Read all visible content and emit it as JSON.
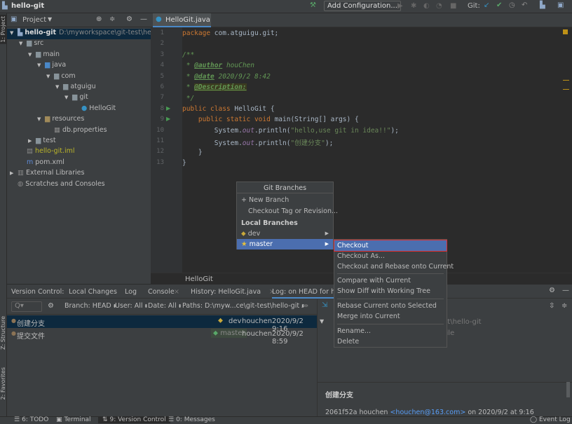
{
  "title": "hello-git",
  "toolbar": {
    "add_config": "Add Configuration...",
    "git_label": "Git:"
  },
  "left_strip": {
    "project": "1: Project",
    "structure": "Z: Structure",
    "favorites": "2: Favorites"
  },
  "project": {
    "header": "Project",
    "tree": [
      {
        "label": "hello-git",
        "path": "D:\\myworkspace\\git-test\\hello-git",
        "indent": 0,
        "icon": "module-folder"
      },
      {
        "label": "src",
        "indent": 1,
        "icon": "folder"
      },
      {
        "label": "main",
        "indent": 2,
        "icon": "folder"
      },
      {
        "label": "java",
        "indent": 3,
        "icon": "source-folder"
      },
      {
        "label": "com",
        "indent": 4,
        "icon": "package"
      },
      {
        "label": "atguigu",
        "indent": 5,
        "icon": "package"
      },
      {
        "label": "git",
        "indent": 6,
        "icon": "package"
      },
      {
        "label": "HelloGit",
        "indent": 7,
        "icon": "class"
      },
      {
        "label": "resources",
        "indent": 3,
        "icon": "resources-folder"
      },
      {
        "label": "db.properties",
        "indent": 4,
        "icon": "properties-file"
      },
      {
        "label": "test",
        "indent": 2,
        "icon": "folder"
      },
      {
        "label": "hello-git.iml",
        "indent": 1,
        "icon": "iml-file"
      },
      {
        "label": "pom.xml",
        "indent": 1,
        "icon": "maven-file"
      },
      {
        "label": "External Libraries",
        "indent": 0,
        "icon": "libraries"
      },
      {
        "label": "Scratches and Consoles",
        "indent": 0,
        "icon": "scratches"
      }
    ]
  },
  "editor": {
    "tab": "HelloGit.java",
    "breadcrumb": "HelloGit",
    "lines": [
      "1",
      "2",
      "3",
      "4",
      "5",
      "6",
      "7",
      "8",
      "9",
      "10",
      "11",
      "12",
      "13"
    ],
    "code": {
      "l1a": "package",
      "l1b": " com.atguigu.git;",
      "l3": "/**",
      "l4a": " * ",
      "l4b": "@author",
      "l4c": " houChen",
      "l5a": " * ",
      "l5b": "@date",
      "l5c": " 2020/9/2 8:42",
      "l6a": " * ",
      "l6b": "@Description:",
      "l7": " */",
      "l8a": "public class",
      "l8b": " HelloGit {",
      "l9a": "    public static void",
      "l9b": " main(String[] args) {",
      "l10a": "        System.",
      "l10b": "out",
      "l10c": ".println(",
      "l10d": "\"hello,use git in idea!!\"",
      "l10e": ");",
      "l11a": "        System.",
      "l11b": "out",
      "l11c": ".println(",
      "l11d": "\"创建分支\"",
      "l11e": ");",
      "l12": "    }",
      "l13": "}"
    }
  },
  "bottom": {
    "tabs": [
      "Version Control:",
      "Local Changes",
      "Log",
      "Console",
      "History: HelloGit.java",
      "Log: on HEAD for hello-git"
    ],
    "filters": [
      "Branch: HEAD",
      "User: All",
      "Date: All",
      "Paths: D:\\myw...ce\\git-test\\hello-git"
    ],
    "commits": [
      {
        "msg": "创建分支",
        "ref": "dev",
        "author": "houchen",
        "date": "2020/9/2 9:16"
      },
      {
        "msg": "提交文件",
        "ref": "master",
        "author": "houchen",
        "date": "2020/9/2 8:59"
      }
    ],
    "changes_path": "test\\hello-git",
    "changes_file": "file",
    "detail": {
      "title": "创建分支",
      "hash": "2061f52a",
      "author": "houchen",
      "email": "<houchen@163.com>",
      "on": "on 2020/9/2 at 9:16"
    }
  },
  "popup": {
    "title": "Git Branches",
    "new_branch": "New Branch",
    "checkout_tag": "Checkout Tag or Revision...",
    "local_header": "Local Branches",
    "branches": [
      "dev",
      "master"
    ]
  },
  "submenu": [
    "Checkout",
    "Checkout As...",
    "Checkout and Rebase onto Current",
    "Compare with Current",
    "Show Diff with Working Tree",
    "Rebase Current onto Selected",
    "Merge into Current",
    "Rename...",
    "Delete"
  ],
  "status": {
    "tabs": [
      "6: TODO",
      "Terminal",
      "9: Version Control",
      "0: Messages"
    ],
    "event_log": "Event Log"
  },
  "colors": {
    "accent": "#4b6eaf",
    "checkout_outline": "#e03030"
  }
}
